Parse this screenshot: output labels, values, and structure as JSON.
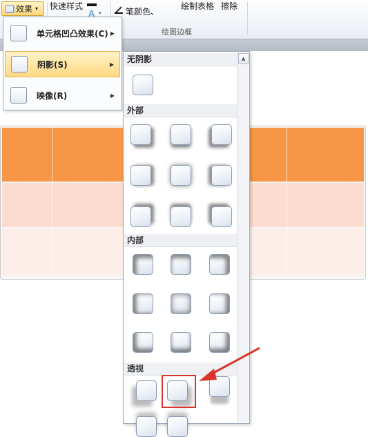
{
  "ribbon": {
    "effects_button": "效果",
    "quick_styles": "快速样式",
    "pen_color": "笔颜色",
    "pen_color_caret": "、",
    "draw_table": "绘制表格",
    "eraser": "擦除",
    "group_label": "绘图边框"
  },
  "effects_menu": {
    "items": [
      {
        "label": "单元格凹凸效果(C)",
        "icon": "bevel-icon"
      },
      {
        "label": "阴影(S)",
        "icon": "shadow-icon"
      },
      {
        "label": "映像(R)",
        "icon": "reflection-icon"
      }
    ]
  },
  "shadow_gallery": {
    "sections": {
      "none": "无阴影",
      "outer": "外部",
      "inner": "内部",
      "perspective": "透视"
    }
  },
  "colors": {
    "table_header": "#f79646",
    "table_row_1": "#fcdcd0",
    "table_row_2": "#fdeee9",
    "highlight": "#ffd982",
    "annotation_red": "#d9342b"
  }
}
